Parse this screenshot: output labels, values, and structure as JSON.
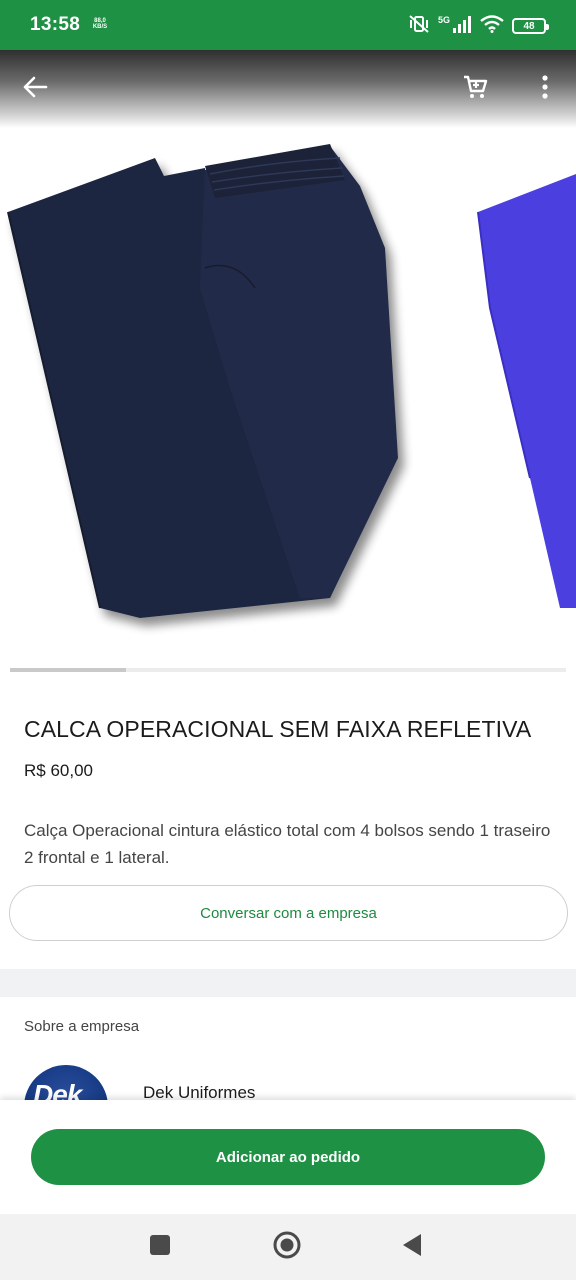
{
  "status_bar": {
    "time": "13:58",
    "speed_value": "88,0",
    "speed_unit": "KB/S",
    "network": "5G",
    "battery": "48"
  },
  "app_bar": {
    "back_icon": "arrow-left-icon",
    "cart_icon": "cart-icon",
    "menu_icon": "more-vertical-icon"
  },
  "carousel": {
    "images": [
      "navy-operational-pants",
      "purple-garment-partial"
    ],
    "current_index": 0,
    "colors": {
      "pants": "#1f2740",
      "next_item": "#4b3fe0"
    }
  },
  "product": {
    "title": "CALCA OPERACIONAL SEM FAIXA REFLETIVA",
    "price": "R$ 60,00",
    "description": "Calça Operacional cintura elástico total com 4 bolsos sendo 1 traseiro 2 frontal e 1 lateral."
  },
  "actions": {
    "chat_label": "Conversar com a empresa",
    "add_label": "Adicionar ao pedido"
  },
  "company": {
    "section_label": "Sobre a empresa",
    "name": "Dek Uniformes",
    "logo_text": "Dek"
  },
  "nav": {
    "recent_icon": "square-icon",
    "home_icon": "circle-home-icon",
    "back_icon": "triangle-back-icon"
  },
  "colors": {
    "brand_green": "#1f9145",
    "link_green": "#1e8a42"
  }
}
